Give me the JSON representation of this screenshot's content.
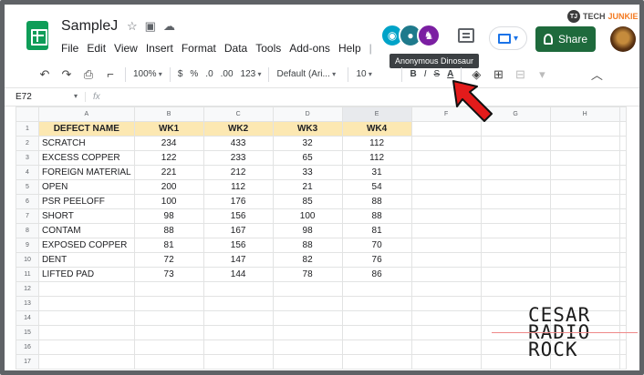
{
  "app": {
    "title": "SampleJ",
    "menu": [
      "File",
      "Edit",
      "View",
      "Insert",
      "Format",
      "Data",
      "Tools",
      "Add-ons",
      "Help"
    ]
  },
  "brand": {
    "tj": "TJ",
    "tech": "TECH",
    "junkie": "JUNKIE"
  },
  "collaborators": {
    "tooltip": "Anonymous Dinosaur"
  },
  "share": {
    "label": "Share"
  },
  "toolbar": {
    "zoom": "100%",
    "currency": "$",
    "percent": "%",
    "dec_dec": ".0",
    "inc_dec": ".00",
    "more_formats": "123",
    "font": "Default (Ari...",
    "font_size": "10",
    "bold": "B",
    "italic": "I",
    "strike": "S"
  },
  "formula_bar": {
    "cell_ref": "E72",
    "fx": "fx"
  },
  "grid": {
    "columns": [
      "A",
      "B",
      "C",
      "D",
      "E",
      "F",
      "G",
      "H"
    ],
    "rows": [
      [
        "DEFECT NAME",
        "WK1",
        "WK2",
        "WK3",
        "WK4"
      ],
      [
        "SCRATCH",
        "234",
        "433",
        "32",
        "112"
      ],
      [
        "EXCESS COPPER",
        "122",
        "233",
        "65",
        "112"
      ],
      [
        "FOREIGN MATERIAL",
        "221",
        "212",
        "33",
        "31"
      ],
      [
        "OPEN",
        "200",
        "112",
        "21",
        "54"
      ],
      [
        "PSR PEELOFF",
        "100",
        "176",
        "85",
        "88"
      ],
      [
        "SHORT",
        "98",
        "156",
        "100",
        "88"
      ],
      [
        "CONTAM",
        "88",
        "167",
        "98",
        "81"
      ],
      [
        "EXPOSED COPPER",
        "81",
        "156",
        "88",
        "70"
      ],
      [
        "DENT",
        "72",
        "147",
        "82",
        "76"
      ],
      [
        "LIFTED PAD",
        "73",
        "144",
        "78",
        "86"
      ]
    ],
    "row_numbers": [
      "1",
      "2",
      "3",
      "4",
      "5",
      "6",
      "7",
      "8",
      "9",
      "10",
      "11",
      "12",
      "13",
      "14",
      "15",
      "16",
      "17"
    ]
  },
  "watermark": {
    "line1": "CESAR",
    "line2": "RADIO",
    "line3": "ROCK"
  }
}
